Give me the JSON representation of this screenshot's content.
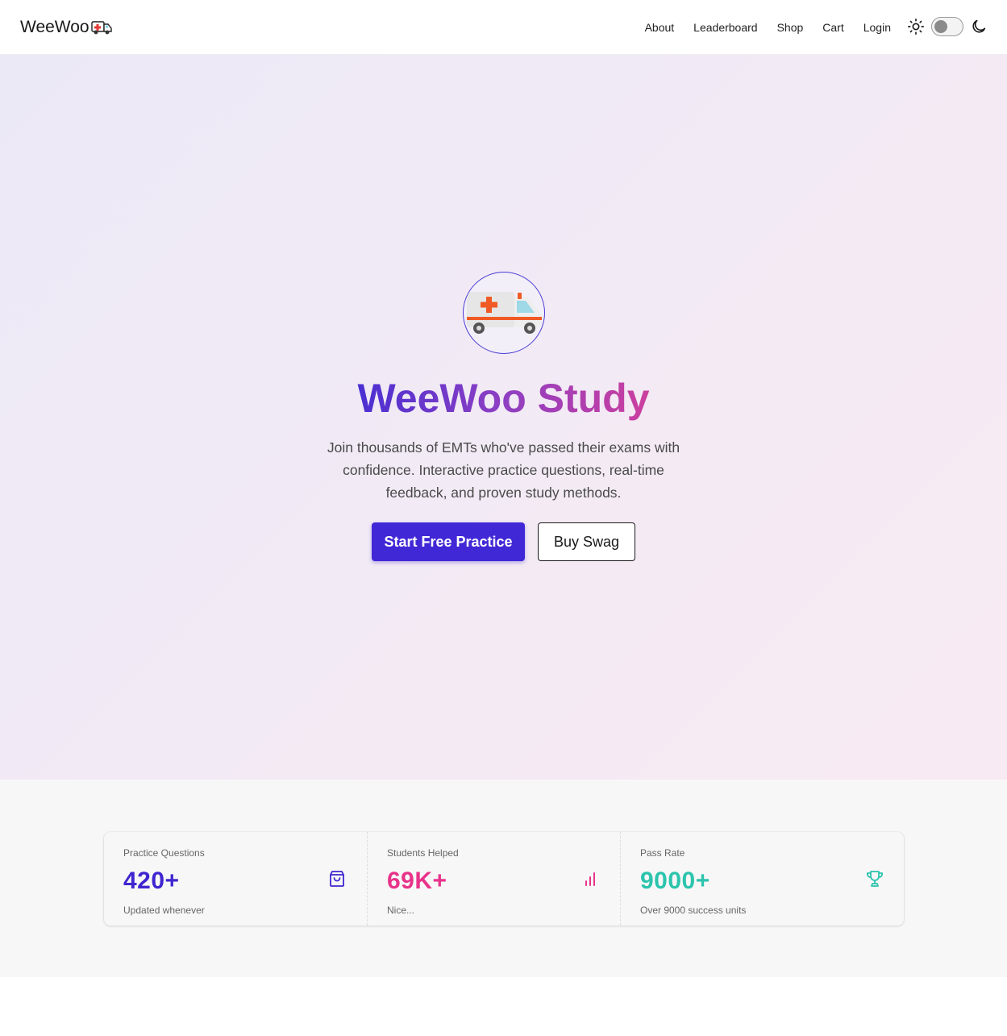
{
  "nav": {
    "brand": "WeeWoo",
    "brand_icon": "ambulance-icon",
    "links": [
      "About",
      "Leaderboard",
      "Shop",
      "Cart",
      "Login"
    ],
    "theme_icons": [
      "sun-icon",
      "moon-icon"
    ]
  },
  "hero": {
    "logo_icon": "ambulance-icon",
    "title": "WeeWoo Study",
    "description": "Join thousands of EMTs who've passed their exams with confidence. Interactive practice questions, real-time feedback, and proven study methods.",
    "primary_button": "Start Free Practice",
    "secondary_button": "Buy Swag"
  },
  "stats": [
    {
      "label": "Practice Questions",
      "value": "420+",
      "description": "Updated whenever",
      "icon": "shopping-bag-icon",
      "color": "#3f26d0"
    },
    {
      "label": "Students Helped",
      "value": "69K+",
      "description": "Nice...",
      "icon": "bar-chart-icon",
      "color": "#e8338a"
    },
    {
      "label": "Pass Rate",
      "value": "9000+",
      "description": "Over 9000 success units",
      "icon": "trophy-icon",
      "color": "#2cc4ad"
    }
  ],
  "colors": {
    "primary": "#4128d6",
    "accent_pink": "#e8338a",
    "accent_teal": "#2cc4ad"
  }
}
